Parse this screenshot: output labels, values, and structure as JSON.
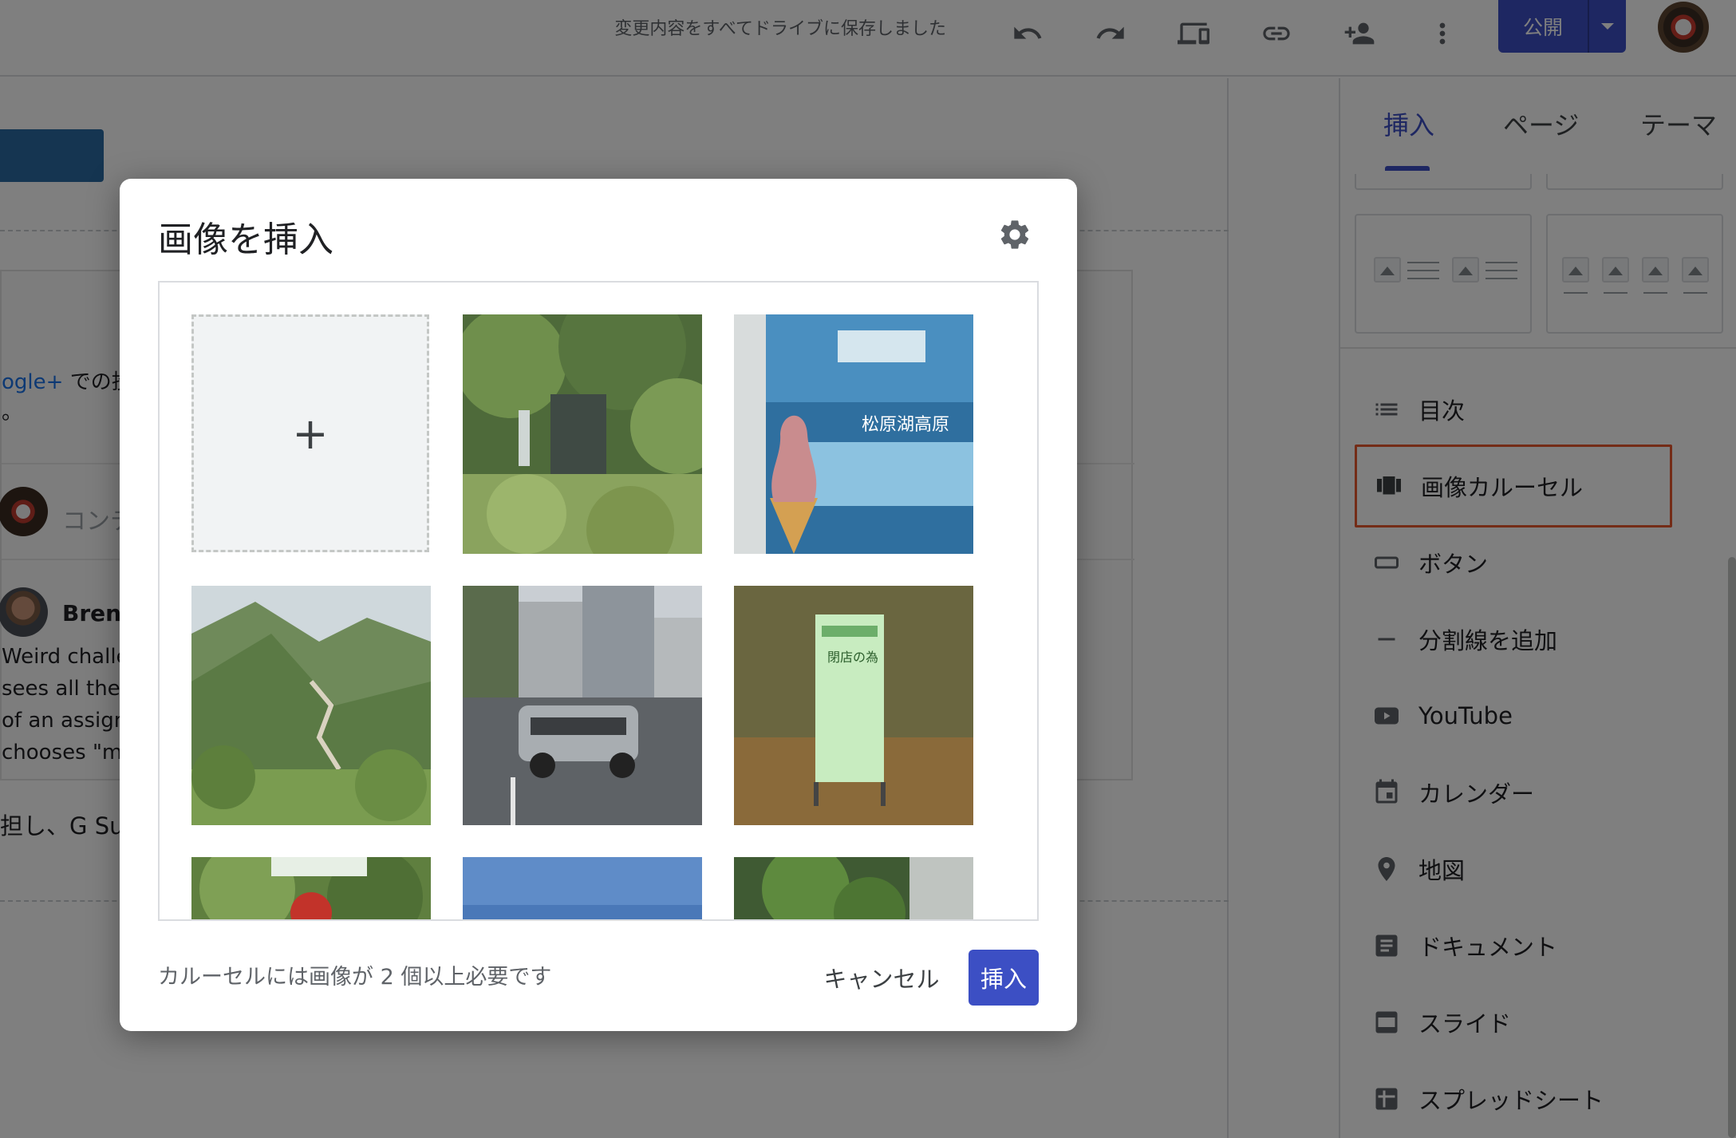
{
  "topbar": {
    "save_status": "変更内容をすべてドライブに保存しました",
    "icons": [
      "undo-icon",
      "redo-icon",
      "preview-devices-icon",
      "link-icon",
      "share-add-person-icon",
      "more-vert-icon"
    ],
    "publish_label": "公開"
  },
  "canvas": {
    "google_plus_link": "ogle+",
    "post_text": "での投稿",
    "period": "。",
    "comment_placeholder": "コンテ",
    "author": "Brent",
    "body_lines": [
      "Weird challen",
      "sees all the a",
      "of an assignm",
      "chooses \"ma"
    ],
    "footer_text": "担し、G Suit"
  },
  "panel": {
    "tabs": [
      "挿入",
      "ページ",
      "テーマ"
    ],
    "active_tab": "挿入",
    "items": [
      {
        "label": "目次",
        "icon": "table-of-contents-icon"
      },
      {
        "label": "画像カルーセル",
        "icon": "image-carousel-icon"
      },
      {
        "label": "ボタン",
        "icon": "button-icon"
      },
      {
        "label": "分割線を追加",
        "icon": "divider-icon"
      },
      {
        "label": "YouTube",
        "icon": "youtube-icon"
      },
      {
        "label": "カレンダー",
        "icon": "calendar-icon"
      },
      {
        "label": "地図",
        "icon": "map-pin-icon"
      },
      {
        "label": "ドキュメント",
        "icon": "document-icon"
      },
      {
        "label": "スライド",
        "icon": "slides-icon"
      },
      {
        "label": "スプレッドシート",
        "icon": "spreadsheet-icon"
      }
    ],
    "highlighted_item": "画像カルーセル",
    "highlight_color": "#e8582f"
  },
  "modal": {
    "title": "画像を挿入",
    "add_tile_symbol": "+",
    "photos": [
      {
        "name": "waterfall-forest-photo"
      },
      {
        "name": "soft-serve-ice-cream-photo"
      },
      {
        "name": "mountain-valley-photo"
      },
      {
        "name": "delorean-street-photo"
      },
      {
        "name": "closing-notice-sign-photo"
      },
      {
        "name": "red-flower-leaves-photo"
      },
      {
        "name": "blue-sky-photo"
      },
      {
        "name": "green-plant-photo"
      }
    ],
    "sign_text": "閉店の為",
    "sign_text_2": "松原湖高原",
    "footer_message": "カルーセルには画像が 2 個以上必要です",
    "cancel_label": "キャンセル",
    "insert_label": "挿入"
  },
  "colors": {
    "accent": "#3c4fc4",
    "overlay": "rgba(0,0,0,0.5)"
  }
}
